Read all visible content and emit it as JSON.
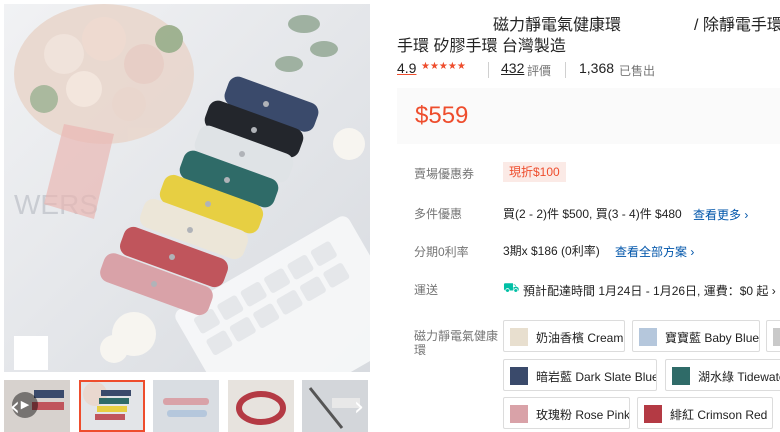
{
  "product": {
    "title_line1_a": "磁力靜電氣健康環",
    "title_line1_b": "/ 除靜電手環",
    "title_line2": "手環 矽膠手環 台灣製造",
    "rating": "4.9",
    "stars": "★★★★★",
    "reviews_count": "432",
    "reviews_label": "評價",
    "sold_count": "1,368",
    "sold_label": "已售出",
    "price": "$559"
  },
  "details": {
    "coupon_label": "賣場優惠券",
    "coupon_value": "現折$100",
    "bundle_label": "多件優惠",
    "bundle_value": "買(2 - 2)件 $500, 買(3 - 4)件 $480",
    "bundle_link": "查看更多 ›",
    "installment_label": "分期0利率",
    "installment_value": "3期x $186 (0利率)",
    "installment_link": "查看全部方案 ›",
    "shipping_label": "運送",
    "shipping_icon": "truck-icon",
    "shipping_value": "預計配達時間 1月24日 - 1月26日, 運費：$0 起 ›"
  },
  "variants": {
    "label": "磁力靜電氣健康環",
    "options": [
      {
        "label": "奶油香檳 Cream",
        "swatch": "#e8dfcf"
      },
      {
        "label": "寶寶藍 Baby Blue",
        "swatch": "#b5c7dc"
      },
      {
        "label": "暗岩藍 Dark Slate Blue",
        "swatch": "#3a4a6b"
      },
      {
        "label": "湖水綠 Tidewater",
        "swatch": "#2f6b68"
      },
      {
        "label": "玫瑰粉 Rose Pink",
        "swatch": "#d9a2a8"
      },
      {
        "label": "緋紅 Crimson Red",
        "swatch": "#b43a44"
      }
    ]
  },
  "gallery": {
    "photo_text": "WERS",
    "prev_arrow": "‹",
    "next_arrow": "›",
    "play_icon": "▶"
  },
  "colors": {
    "accent": "#ee4d2d",
    "link": "#0055aa",
    "shipping": "#00bfa5"
  }
}
